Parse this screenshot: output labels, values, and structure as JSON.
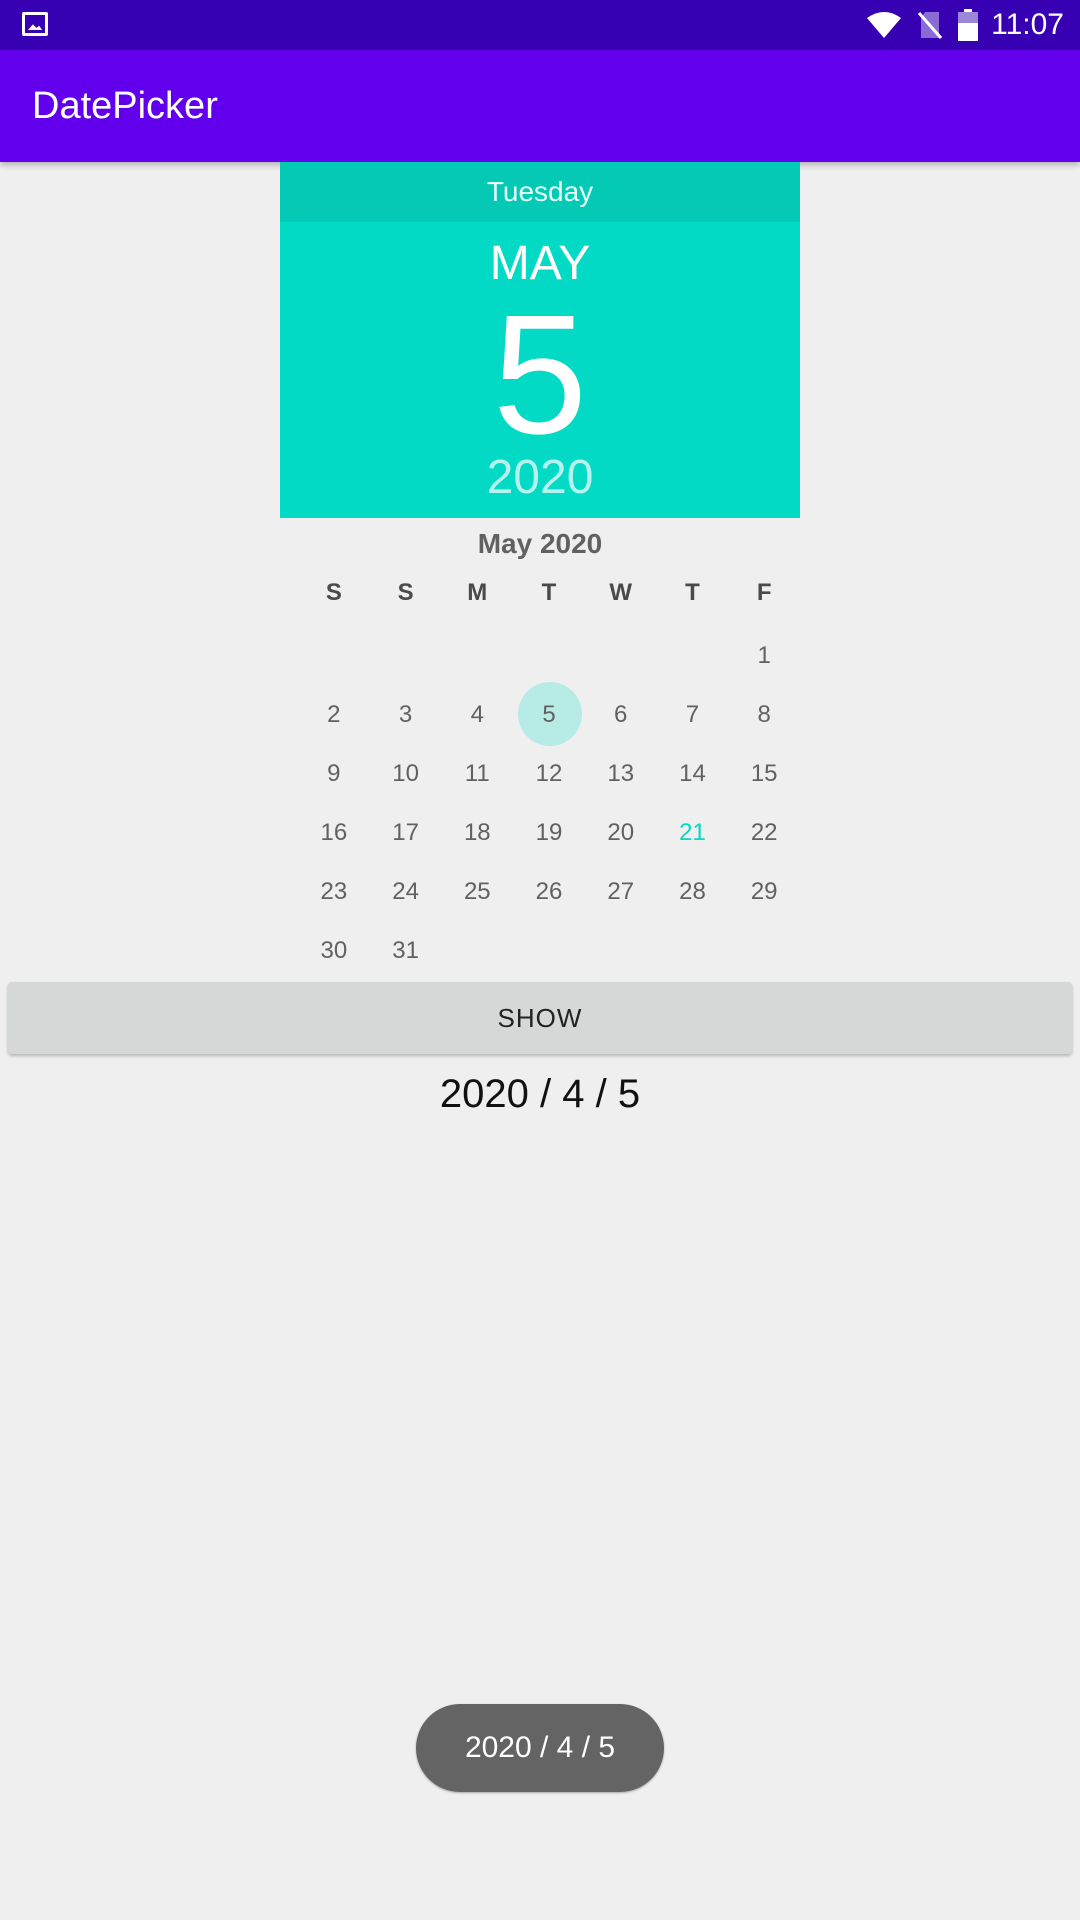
{
  "status_bar": {
    "time": "11:07",
    "left_icon": "image-icon",
    "right_icons": [
      "wifi-icon",
      "no-sim-icon",
      "battery-icon"
    ]
  },
  "app_bar": {
    "title": "DatePicker"
  },
  "date_picker": {
    "header_day_of_week": "Tuesday",
    "header_month": "MAY",
    "header_day": "5",
    "header_year": "2020",
    "month_title": "May 2020",
    "weekday_labels": [
      "S",
      "S",
      "M",
      "T",
      "W",
      "T",
      "F"
    ],
    "weeks": [
      [
        "",
        "",
        "",
        "",
        "",
        "",
        "1"
      ],
      [
        "2",
        "3",
        "4",
        "5",
        "6",
        "7",
        "8"
      ],
      [
        "9",
        "10",
        "11",
        "12",
        "13",
        "14",
        "15"
      ],
      [
        "16",
        "17",
        "18",
        "19",
        "20",
        "21",
        "22"
      ],
      [
        "23",
        "24",
        "25",
        "26",
        "27",
        "28",
        "29"
      ],
      [
        "30",
        "31",
        "",
        "",
        "",
        "",
        ""
      ]
    ],
    "selected_day": "5",
    "today_day": "21"
  },
  "show_button": {
    "label": "SHOW"
  },
  "result_text": "2020 / 4 / 5",
  "toast": {
    "text": "2020 / 4 / 5"
  },
  "colors": {
    "status_bar": "#3700b3",
    "app_bar": "#6200ee",
    "accent": "#03dac5",
    "accent_dark": "#03c9b5",
    "selected_circle": "#b7ece6",
    "background": "#efefef"
  }
}
